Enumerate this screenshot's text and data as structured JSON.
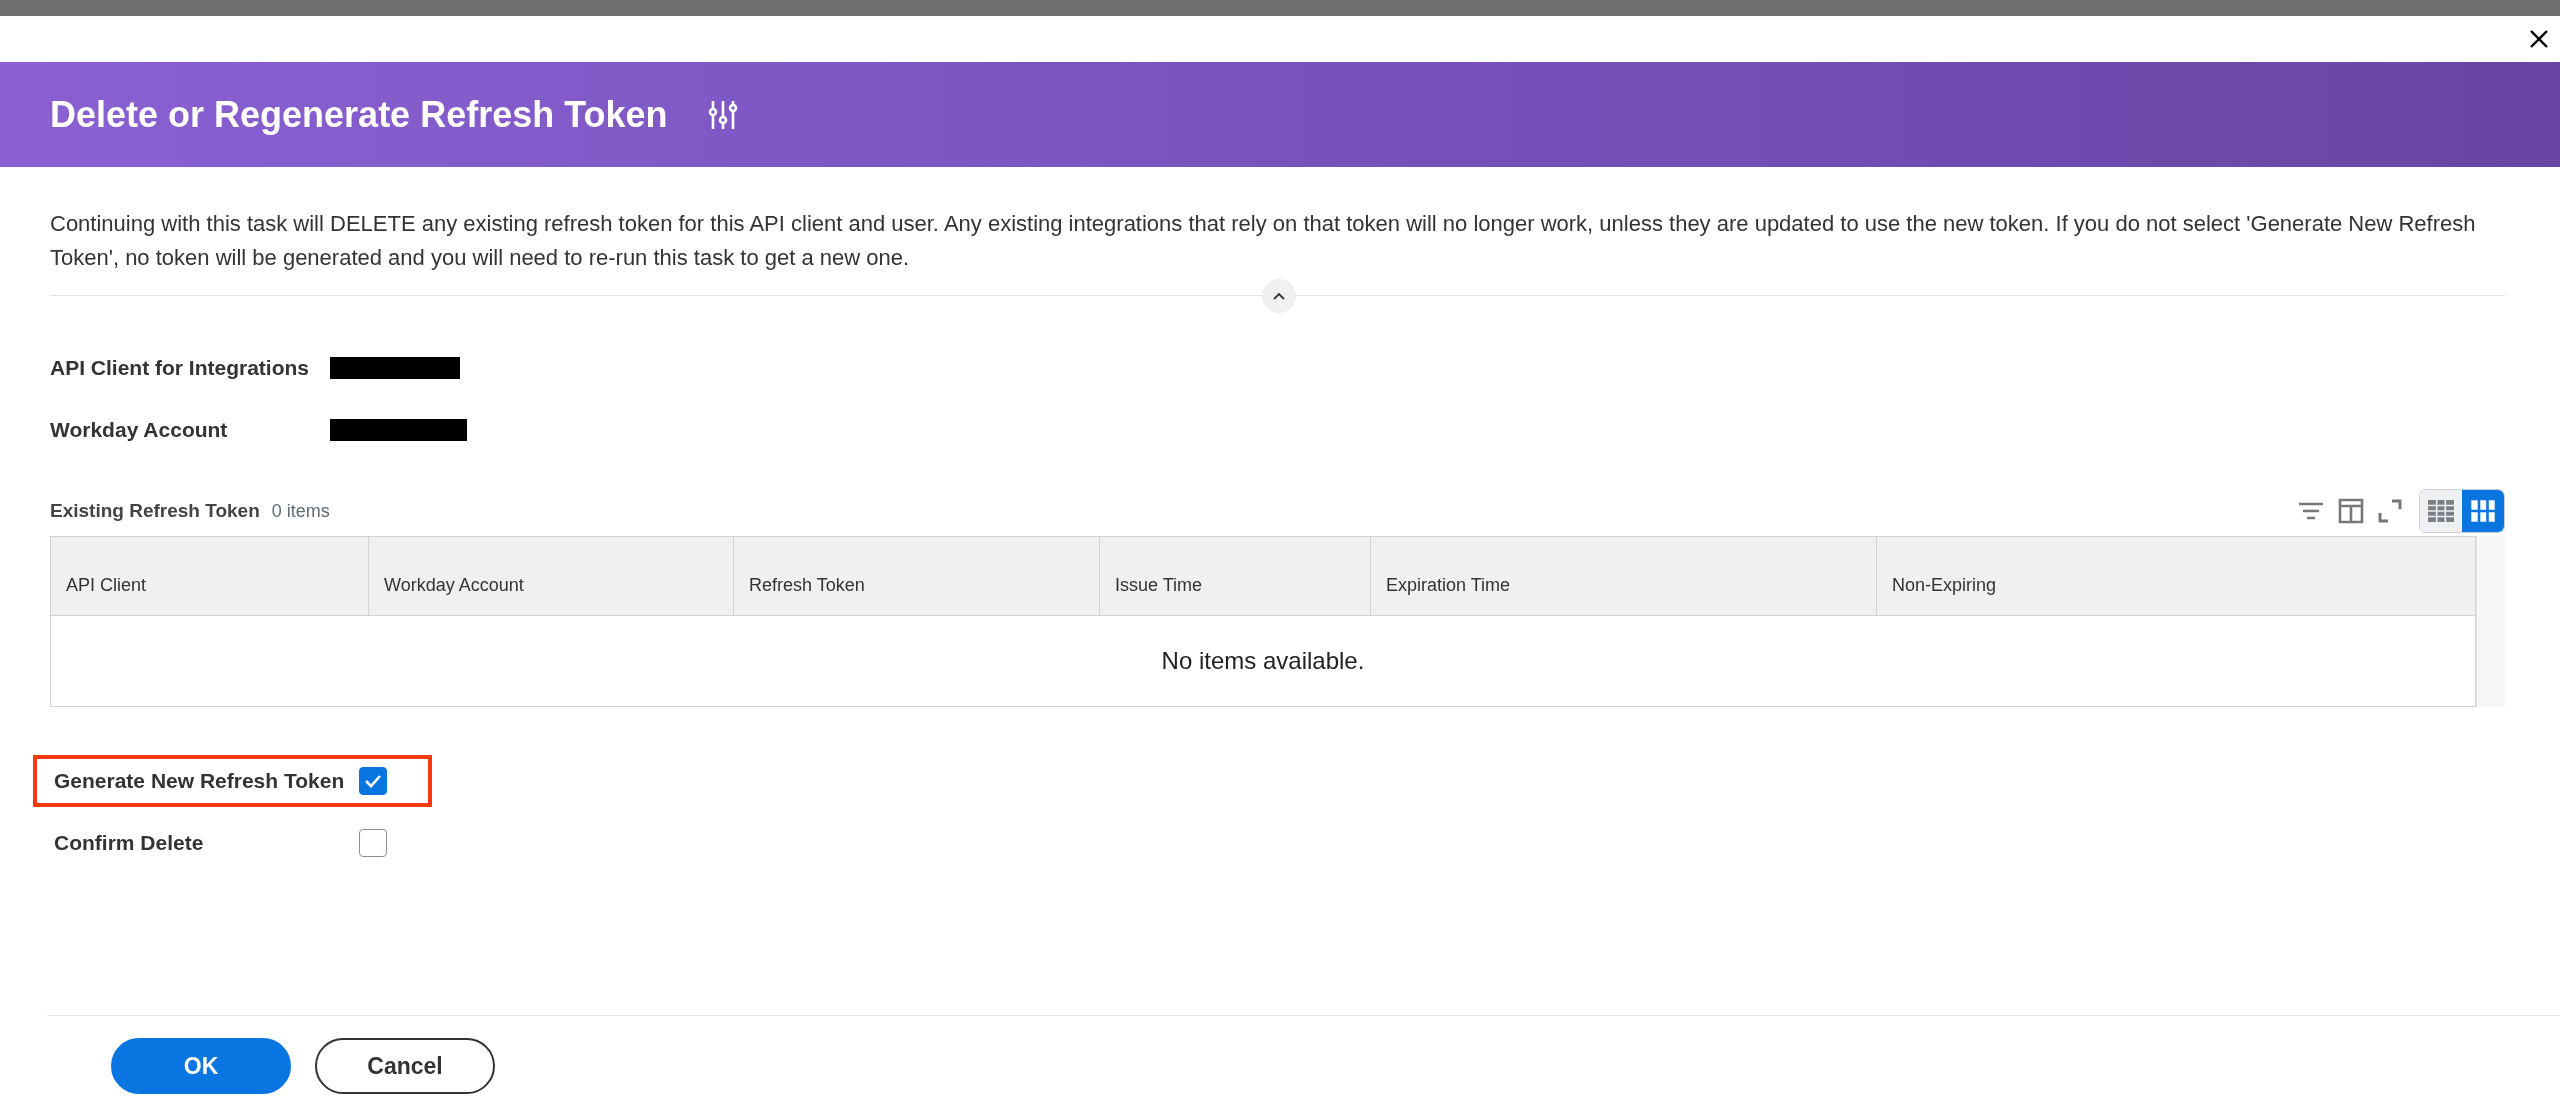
{
  "dialog": {
    "title": "Delete or Regenerate Refresh Token"
  },
  "description": "Continuing with this task will DELETE any existing refresh token for this API client and user. Any existing integrations that rely on that token will no longer work, unless they are updated to use the new token. If you do not select 'Generate New Refresh Token', no token will be generated and you will need to re-run this task to get a new one.",
  "fields": [
    {
      "label": "API Client for Integrations",
      "redacted": true
    },
    {
      "label": "Workday Account",
      "redacted": true
    }
  ],
  "table": {
    "title": "Existing Refresh Token",
    "count": "0 items",
    "view_toggle": [
      {
        "kind": "list",
        "selected": false
      },
      {
        "kind": "grid",
        "selected": true
      }
    ],
    "columns": [
      "API Client",
      "Workday Account",
      "Refresh Token",
      "Issue Time",
      "Expiration Time",
      "Non-Expiring"
    ],
    "empty_message": "No items available."
  },
  "checkboxes": [
    {
      "label": "Generate New Refresh Token",
      "checked": true,
      "highlighted": true
    },
    {
      "label": "Confirm Delete",
      "checked": false,
      "highlighted": false
    }
  ],
  "buttons": [
    {
      "label": "OK",
      "kind": "primary"
    },
    {
      "label": "Cancel",
      "kind": "secondary"
    }
  ]
}
